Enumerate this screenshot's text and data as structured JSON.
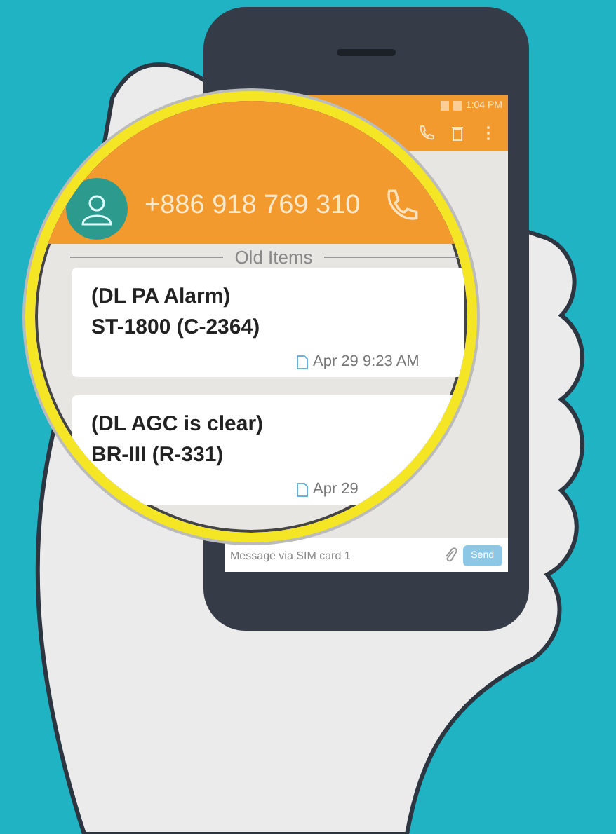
{
  "status_bar": {
    "time": "1:04 PM"
  },
  "conversation": {
    "contact": "+886 918 769 310",
    "section_label": "Old Items"
  },
  "messages": [
    {
      "lines": [
        "(DL PA Alarm)",
        "ST-1800 (C-2364)"
      ],
      "time": "Apr 29 9:23 AM"
    },
    {
      "lines": [
        "(DL AGC is clear)",
        "BR-III (R-331)"
      ],
      "time": "Apr 29"
    }
  ],
  "composer": {
    "placeholder": "Message via SIM card 1",
    "send": "Send"
  }
}
